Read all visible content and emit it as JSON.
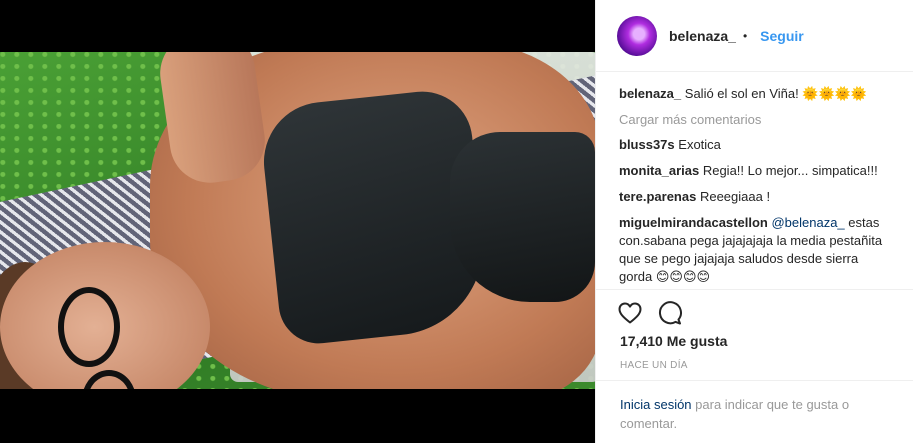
{
  "post": {
    "author": "belenaza_",
    "separator": "•",
    "follow_label": "Seguir",
    "image_alt": "photo-of-woman-sunbathing-on-lounger"
  },
  "caption": {
    "user": "belenaza_",
    "text": "Salió el sol en Viña! 🌞🌞🌞🌞"
  },
  "load_more_label": "Cargar más comentarios",
  "comments": [
    {
      "user": "bluss37s",
      "text": "Exotica"
    },
    {
      "user": "monita_arias",
      "text": "Regia!! Lo mejor... simpatica!!!"
    },
    {
      "user": "tere.parenas",
      "text": "Reeegiaaa !"
    },
    {
      "user": "miguelmirandacastellon",
      "mention": "@belenaza_",
      "text": " estas con.sabana pega jajajajaja la media pestañita que se pego jajajaja saludos desde sierra gorda 😊😊😊😊"
    }
  ],
  "actions": {
    "like_icon": "heart-outline-icon",
    "comment_icon": "comment-bubble-icon"
  },
  "likes": "17,410 Me gusta",
  "time_ago": "HACE UN DÍA",
  "login": {
    "link_label": "Inicia sesión",
    "rest": " para indicar que te gusta o comentar."
  }
}
